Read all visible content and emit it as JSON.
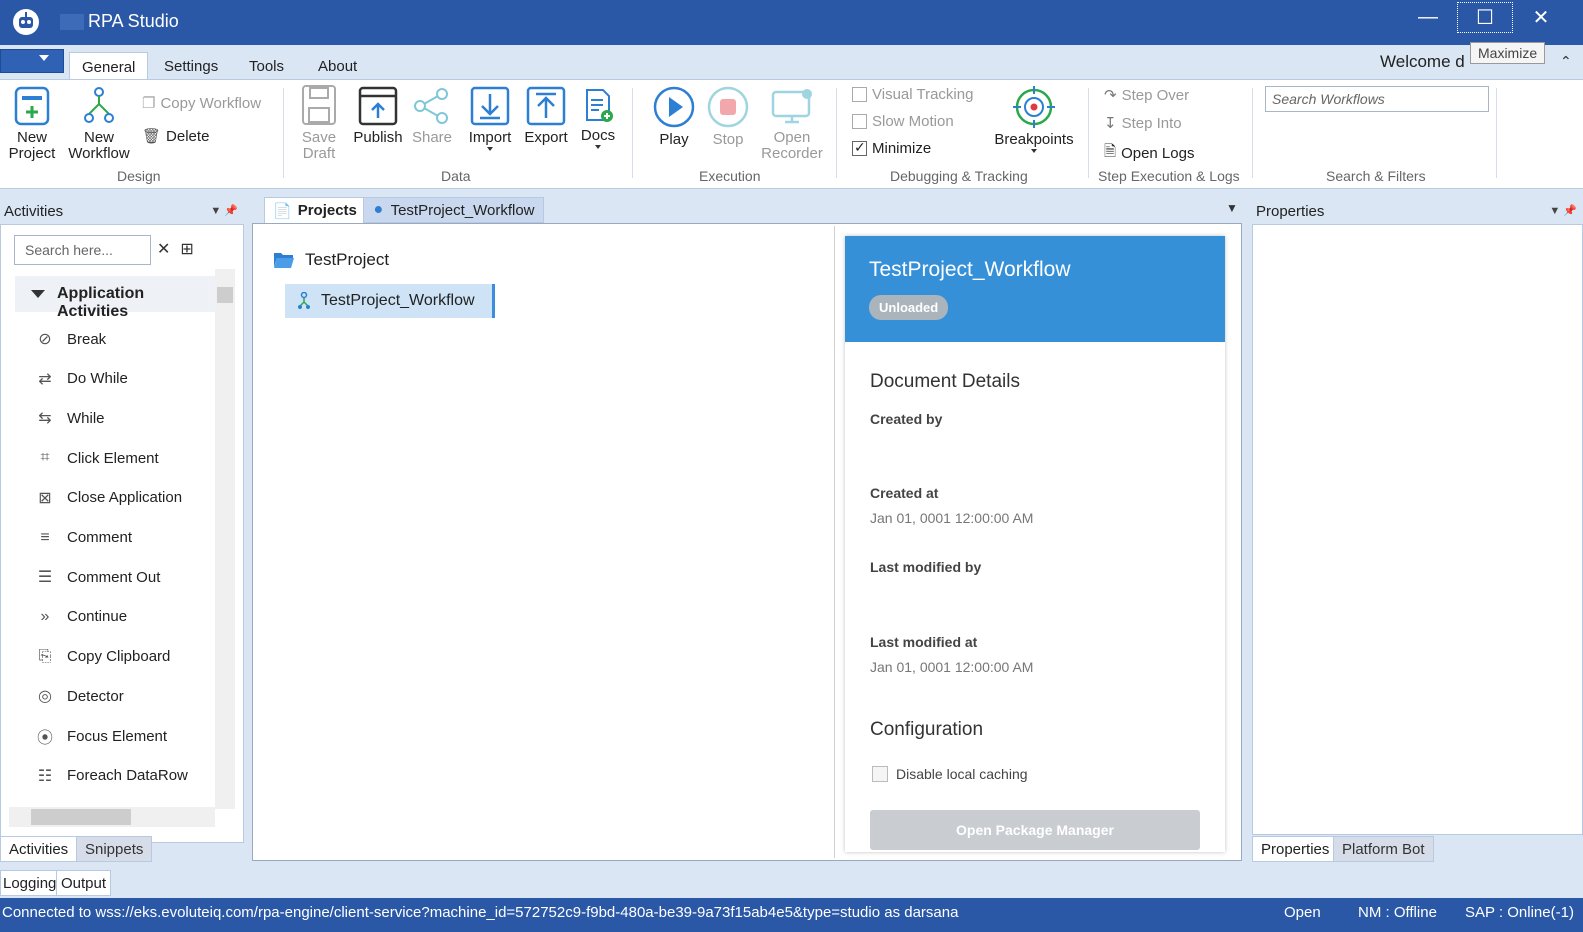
{
  "window": {
    "title": "RPA Studio",
    "tooltip": "Maximize",
    "welcome": "Welcome  d"
  },
  "ribbon_tabs": [
    "General",
    "Settings",
    "Tools",
    "About"
  ],
  "ribbon": {
    "design": {
      "label": "Design",
      "new_project": [
        "New",
        "Project"
      ],
      "new_workflow": [
        "New",
        "Workflow"
      ],
      "copy_workflow": "Copy Workflow",
      "delete": "Delete"
    },
    "data": {
      "label": "Data",
      "save_draft": [
        "Save",
        "Draft"
      ],
      "publish": "Publish",
      "share": "Share",
      "import": "Import",
      "export": "Export",
      "docs": "Docs"
    },
    "execution": {
      "label": "Execution",
      "play": "Play",
      "stop": "Stop",
      "open_recorder": [
        "Open",
        "Recorder"
      ]
    },
    "debugging": {
      "label": "Debugging & Tracking",
      "visual_tracking": "Visual Tracking",
      "slow_motion": "Slow Motion",
      "minimize": "Minimize",
      "minimize_checked": true,
      "breakpoints": "Breakpoints"
    },
    "step": {
      "label": "Step Execution & Logs",
      "step_over": "Step Over",
      "step_into": "Step Into",
      "open_logs": "Open Logs"
    },
    "search": {
      "label": "Search & Filters",
      "placeholder": "Search Workflows"
    }
  },
  "activities": {
    "title": "Activities",
    "search_placeholder": "Search here...",
    "group": "Application Activities",
    "items": [
      {
        "label": "Break",
        "icon": "ban-icon"
      },
      {
        "label": "Do While",
        "icon": "loop-arrows-icon"
      },
      {
        "label": "While",
        "icon": "while-arrows-icon"
      },
      {
        "label": "Click Element",
        "icon": "click-document-icon"
      },
      {
        "label": "Close Application",
        "icon": "close-document-icon"
      },
      {
        "label": "Comment",
        "icon": "comment-icon"
      },
      {
        "label": "Comment Out",
        "icon": "comment-out-icon"
      },
      {
        "label": "Continue",
        "icon": "double-chevron-icon"
      },
      {
        "label": "Copy Clipboard",
        "icon": "clipboard-icon"
      },
      {
        "label": "Detector",
        "icon": "detector-icon"
      },
      {
        "label": "Focus Element",
        "icon": "focus-icon"
      },
      {
        "label": "Foreach DataRow",
        "icon": "datarow-icon"
      }
    ],
    "tabs": [
      "Activities",
      "Snippets"
    ]
  },
  "documents": {
    "tabs": [
      "Projects",
      "TestProject_Workflow"
    ],
    "tree": {
      "root": "TestProject",
      "child": "TestProject_Workflow"
    },
    "details": {
      "title": "TestProject_Workflow",
      "status": "Unloaded",
      "section1": "Document Details",
      "created_by_label": "Created by",
      "created_at_label": "Created at",
      "created_at": "Jan 01, 0001 12:00:00 AM",
      "modified_by_label": "Last modified by",
      "modified_at_label": "Last modified at",
      "modified_at": "Jan 01, 0001 12:00:00 AM",
      "section2": "Configuration",
      "disable_cache": "Disable local caching",
      "package_manager": "Open Package Manager"
    }
  },
  "properties": {
    "title": "Properties",
    "tabs": [
      "Properties",
      "Platform Bot"
    ]
  },
  "bottom_tabs": [
    "Logging",
    "Output"
  ],
  "status": {
    "connection": "Connected to wss://eks.evoluteiq.com/rpa-engine/client-service?machine_id=572752c9-f9bd-480a-be39-9a73f15ab4e5&type=studio as darsana",
    "open": "Open",
    "nm": "NM : Offline",
    "sap": "SAP : Online(-1)"
  },
  "colors": {
    "titlebar": "#2a58a6",
    "accent": "#3590d8",
    "panel_bg": "#dbe6f4"
  }
}
